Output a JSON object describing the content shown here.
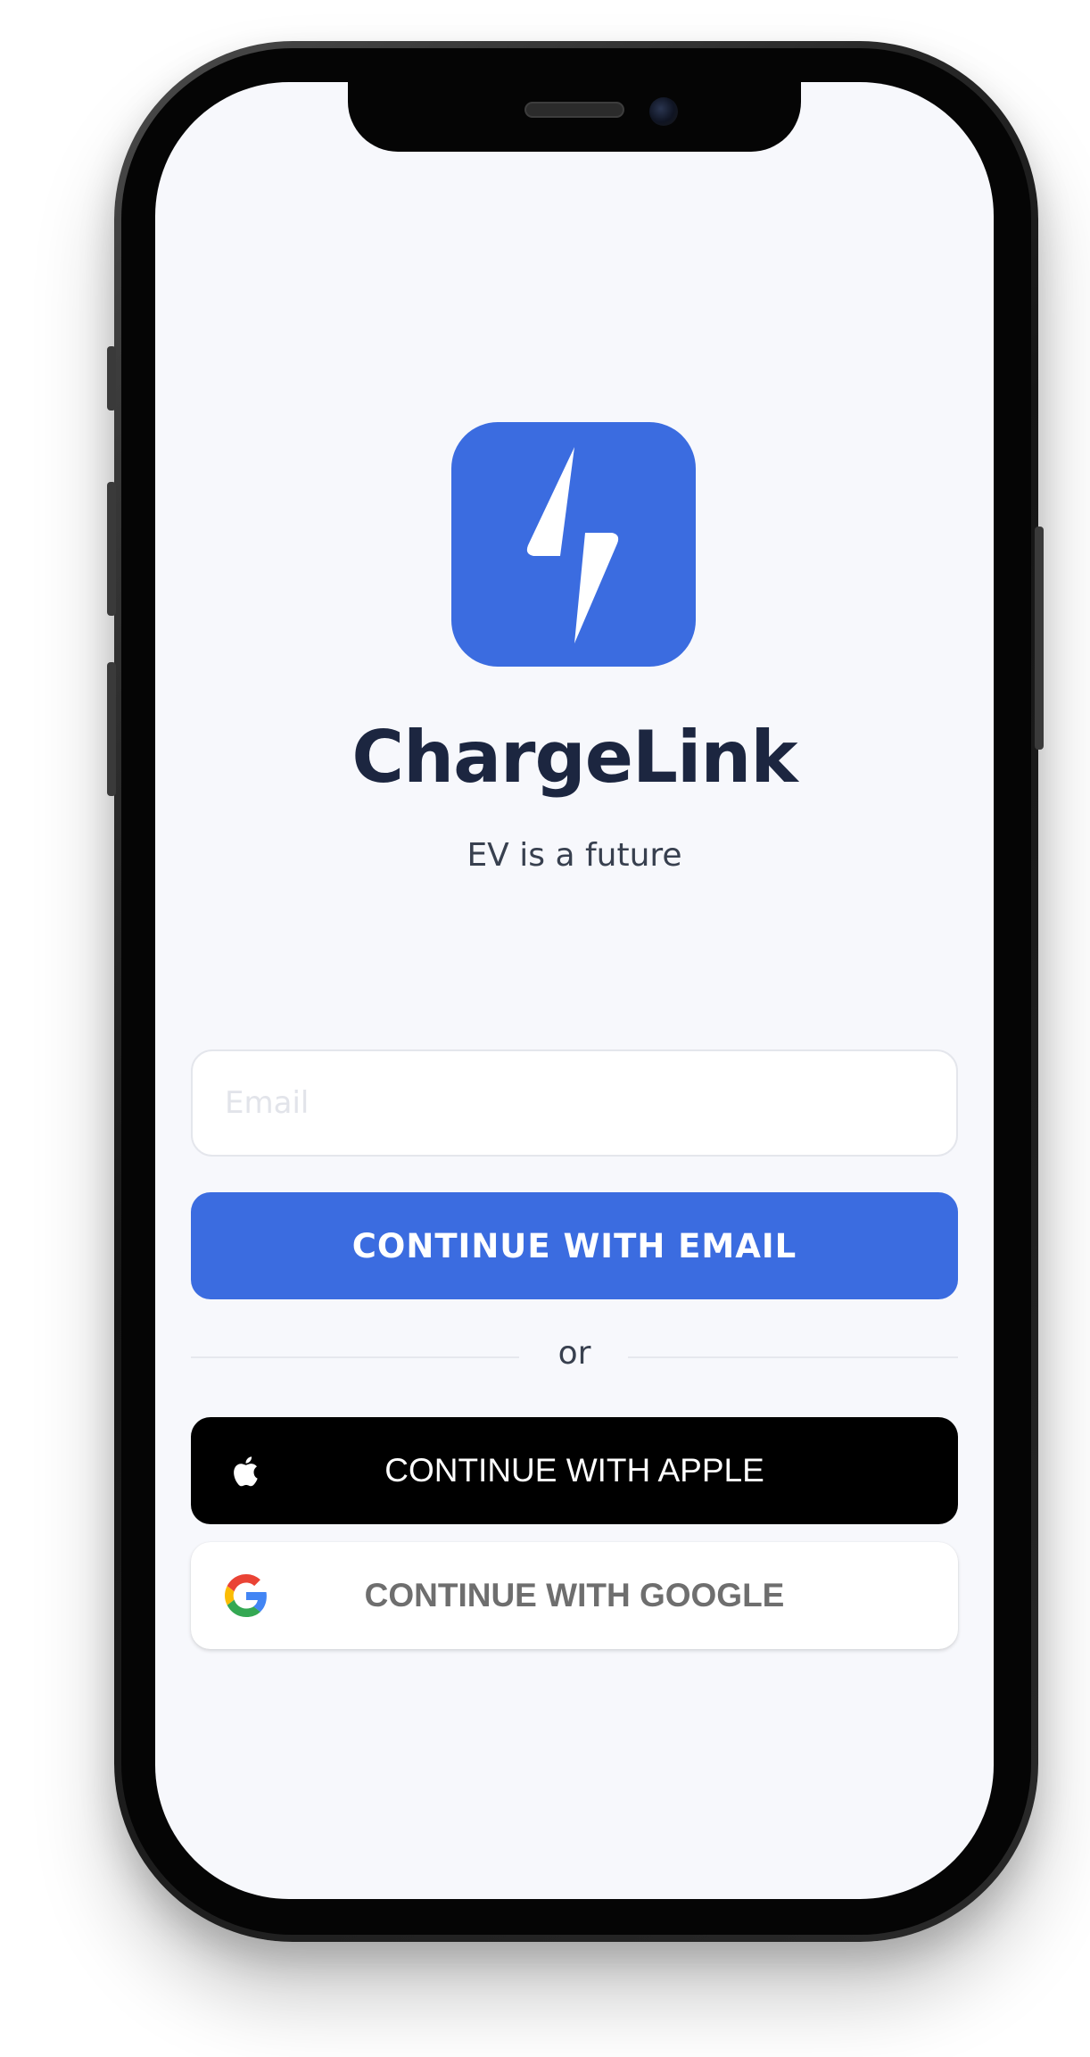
{
  "app": {
    "name": "ChargeLink",
    "tagline": "EV is a future"
  },
  "login": {
    "email_placeholder": "Email",
    "email_value": "",
    "continue_email_label": "CONTINUE WITH EMAIL",
    "divider_label": "or",
    "continue_apple_label": "CONTINUE WITH APPLE",
    "continue_google_label": "CONTINUE WITH GOOGLE"
  },
  "icons": {
    "logo": "lightning-bolt-icon",
    "apple": "apple-icon",
    "google": "google-icon"
  },
  "colors": {
    "primary": "#3b6ce0",
    "brand_text": "#1c2640",
    "background": "#f7f8fc",
    "apple_button": "#000000",
    "google_button": "#ffffff"
  }
}
